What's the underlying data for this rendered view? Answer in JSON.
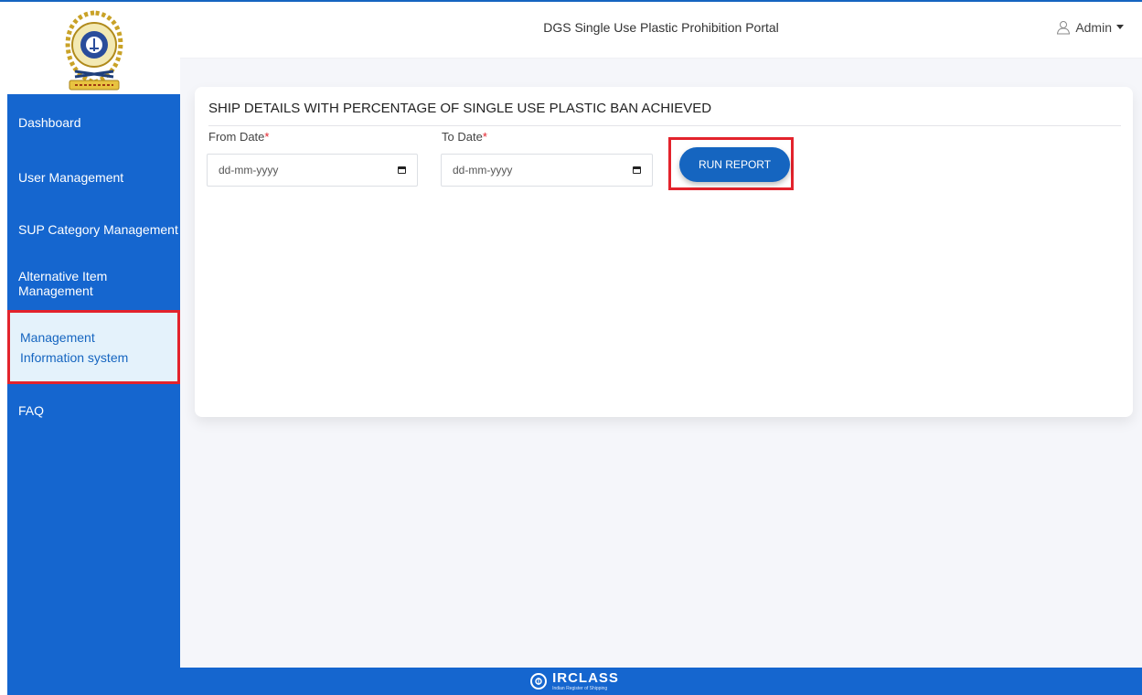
{
  "header": {
    "title": "DGS Single Use Plastic Prohibition Portal",
    "user_label": "Admin"
  },
  "sidebar": {
    "items": [
      {
        "label": "Dashboard"
      },
      {
        "label": "User Management"
      },
      {
        "label": "SUP Category Management"
      },
      {
        "label": "Alternative Item Management"
      },
      {
        "label": "Management Information system",
        "active": true
      },
      {
        "label": "FAQ"
      }
    ]
  },
  "report": {
    "title": "SHIP DETAILS WITH PERCENTAGE OF SINGLE USE PLASTIC BAN ACHIEVED",
    "from_label": "From Date",
    "to_label": "To Date",
    "required_mark": "*",
    "from_placeholder": "dd-mm-yyyy",
    "to_placeholder": "dd-mm-yyyy",
    "run_label": "RUN REPORT"
  },
  "footer": {
    "brand": "IRCLASS",
    "tagline": "Indian Register of Shipping"
  },
  "colors": {
    "primary": "#1566cf",
    "highlight": "#e3232c",
    "active_bg": "#e4f2fb"
  },
  "icons": [
    "emblem-logo",
    "user-icon",
    "caret-down-icon",
    "calendar-icon",
    "irclass-logo-icon"
  ]
}
